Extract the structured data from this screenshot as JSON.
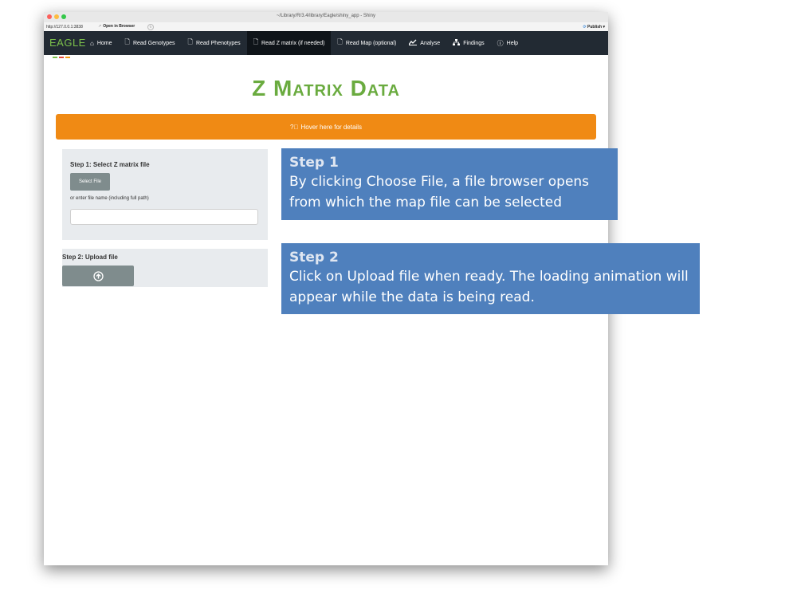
{
  "window": {
    "title": "~/Library/R/3.4/library/Eagle/shiny_app - Shiny",
    "url": "http://127.0.0.1:3838",
    "open_in_browser": "Open in Browser",
    "publish": "Publish"
  },
  "navbar": {
    "brand": "EAGLE",
    "items": [
      {
        "icon": "home-icon",
        "label": "Home"
      },
      {
        "icon": "file-icon",
        "label": "Read Genotypes"
      },
      {
        "icon": "file-icon",
        "label": "Read Phenotypes"
      },
      {
        "icon": "file-icon",
        "label": "Read Z matrix (if needed)"
      },
      {
        "icon": "file-icon",
        "label": "Read Map (optional)"
      },
      {
        "icon": "chart-icon",
        "label": "Analyse"
      },
      {
        "icon": "sitemap-icon",
        "label": "Findings"
      },
      {
        "icon": "question-icon",
        "label": "Help"
      }
    ],
    "active_index": 3
  },
  "main": {
    "heading": "Z Matrix Data",
    "hover_bar": "Hover here for details",
    "step1": {
      "label": "Step 1: Select Z matrix file",
      "select_button": "Select File",
      "or_label": "or enter file name (including full path)",
      "input_value": ""
    },
    "step2": {
      "label": "Step 2: Upload file"
    }
  },
  "callouts": [
    {
      "title": "Step 1",
      "body": "By clicking Choose File, a file browser opens from which the map file can be selected"
    },
    {
      "title": "Step 2",
      "body": "Click on Upload file when ready.  The loading animation will appear while the data is being read."
    }
  ],
  "colors": {
    "navbar_bg": "#222a33",
    "brand_green": "#7cc04b",
    "heading_green": "#6aab3f",
    "hover_bar": "#f08a14",
    "panel_bg": "#e8ebee",
    "button_gray": "#7f8c8d",
    "callout_blue": "#4f80bd"
  }
}
